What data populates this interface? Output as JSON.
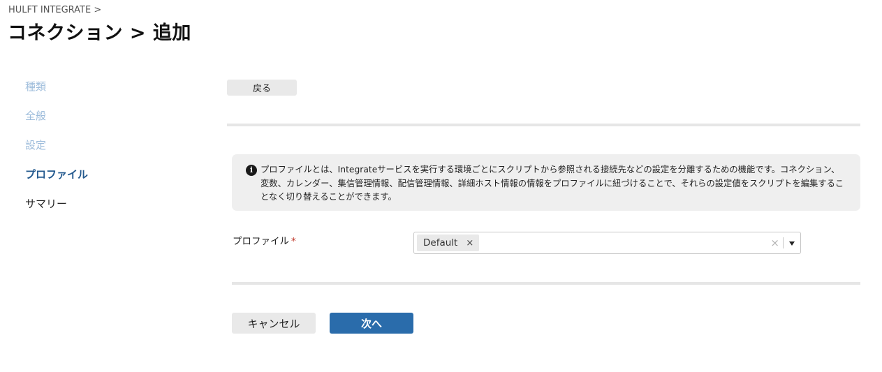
{
  "header": {
    "breadcrumb": "HULFT INTEGRATE >",
    "title": "コネクション > 追加"
  },
  "steps": {
    "items": [
      {
        "label": "種類",
        "state": "done"
      },
      {
        "label": "全般",
        "state": "done"
      },
      {
        "label": "設定",
        "state": "done"
      },
      {
        "label": "プロファイル",
        "state": "current"
      },
      {
        "label": "サマリー",
        "state": "todo"
      }
    ]
  },
  "toolbar": {
    "back_label": "戻る"
  },
  "info": {
    "icon": "info-icon",
    "text": "プロファイルとは、Integrateサービスを実行する環境ごとにスクリプトから参照される接続先などの設定を分離するための機能です。コネクション、変数、カレンダー、集信管理情報、配信管理情報、詳細ホスト情報の情報をプロファイルに紐づけることで、それらの設定値をスクリプトを編集することなく切り替えることができます。"
  },
  "form": {
    "profile_label": "プロファイル",
    "required_mark": "*",
    "selected": [
      "Default"
    ],
    "chip_remove_glyph": "×",
    "clear_glyph": "×"
  },
  "footer": {
    "cancel_label": "キャンセル",
    "next_label": "次へ"
  },
  "colors": {
    "primary": "#2a6cab",
    "step_current": "#23598e",
    "step_done": "#9dbcdb",
    "required": "#c0392b"
  }
}
